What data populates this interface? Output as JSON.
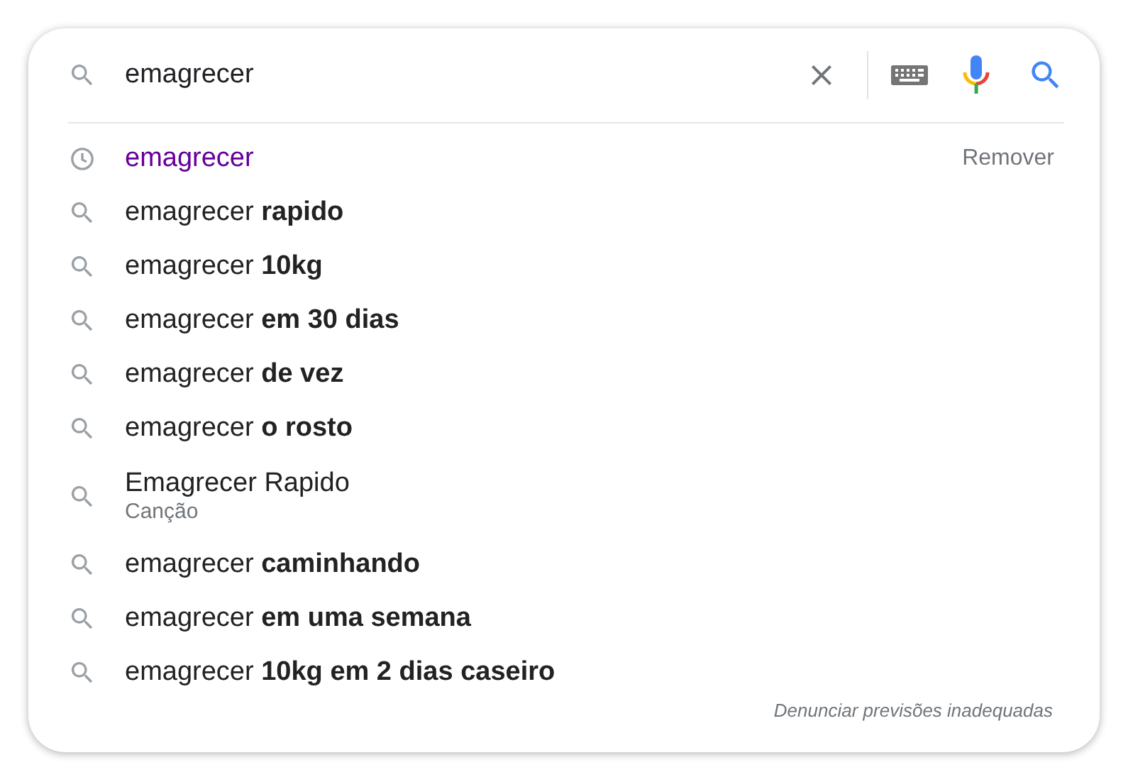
{
  "search": {
    "value": "emagrecer"
  },
  "suggestions": [
    {
      "kind": "history",
      "text": "emagrecer",
      "action": "Remover"
    },
    {
      "kind": "query",
      "text": "emagrecer **rapido**"
    },
    {
      "kind": "query",
      "text": "emagrecer **10kg**"
    },
    {
      "kind": "query",
      "text": "emagrecer **em 30 dias**"
    },
    {
      "kind": "query",
      "text": "emagrecer **de vez**"
    },
    {
      "kind": "query",
      "text": "emagrecer **o rosto**"
    },
    {
      "kind": "entity",
      "text": "Emagrecer Rapido",
      "subtitle": "Canção"
    },
    {
      "kind": "query",
      "text": "emagrecer **caminhando**"
    },
    {
      "kind": "query",
      "text": "emagrecer **em uma semana**"
    },
    {
      "kind": "query",
      "text": "emagrecer **10kg em 2 dias caseiro**"
    }
  ],
  "footer": "Denunciar previsões inadequadas"
}
